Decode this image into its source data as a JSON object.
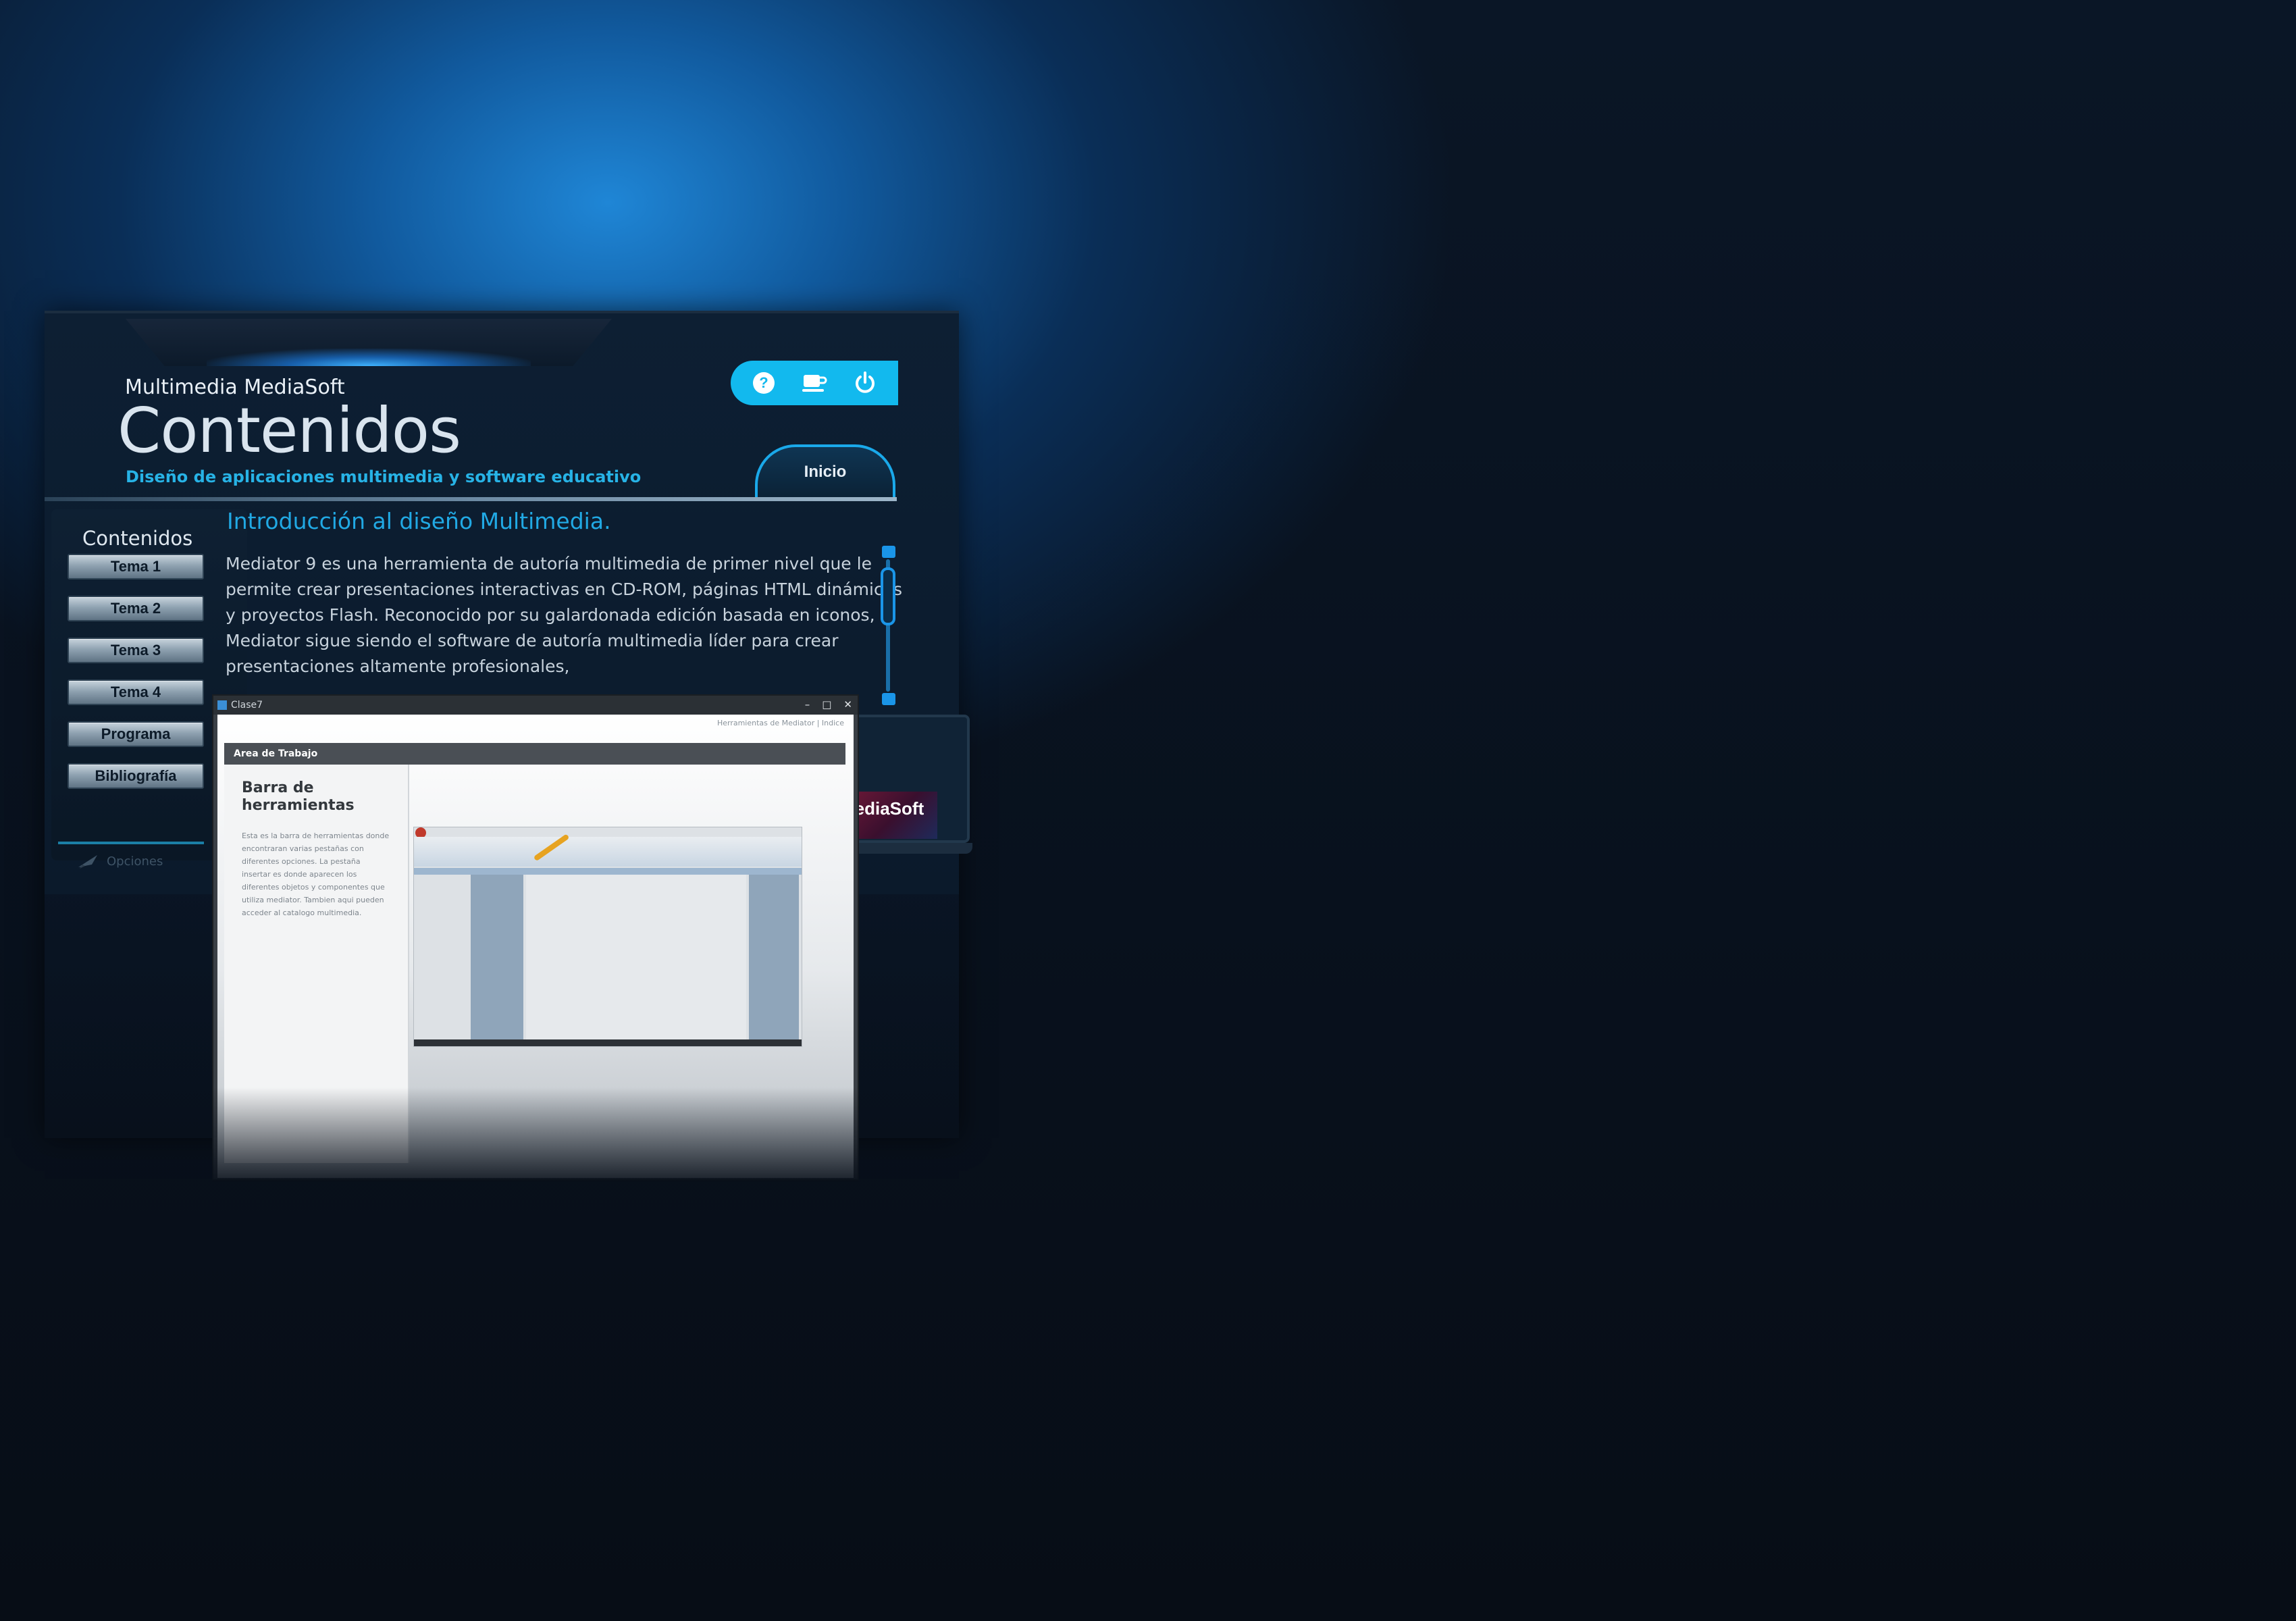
{
  "header": {
    "brand_small": "Multimedia MediaSoft",
    "brand_big": "Contenidos",
    "subtitle": "Diseño de aplicaciones multimedia y software educativo",
    "toolbar_icons": [
      "help-icon",
      "coffee-icon",
      "power-icon"
    ],
    "inicio_label": "Inicio"
  },
  "sidebar": {
    "title": "Contenidos",
    "items": [
      {
        "label": "Tema 1"
      },
      {
        "label": "Tema 2"
      },
      {
        "label": "Tema 3"
      },
      {
        "label": "Tema 4"
      },
      {
        "label": "Programa"
      },
      {
        "label": "Bibliografía"
      }
    ],
    "opciones_label": "Opciones"
  },
  "content": {
    "title": "Introducción al diseño Multimedia.",
    "body": "Mediator 9 es una herramienta de autoría multimedia de primer nivel que le permite crear presentaciones interactivas en CD-ROM, páginas HTML dinámicas y proyectos Flash. Reconocido por su galardonada edición basada en iconos, Mediator sigue siendo el software de autoría multimedia líder para crear presentaciones altamente profesionales,"
  },
  "screenshot": {
    "window_title": "Clase7",
    "breadcrumb": "Herramientas de Mediator  |  Indice",
    "section_bar": "Area de Trabajo",
    "heading": "Barra de herramientas",
    "paragraph": "Esta es la barra de herramientas donde encontraran varias pestañas con diferentes opciones. La pestaña insertar es donde aparecen los diferentes objetos y componentes que utiliza mediator. Tambien aqui pueden acceder al catalogo multimedia."
  },
  "laptop": {
    "brand": "MediaSoft"
  },
  "colors": {
    "accent": "#12b9ee",
    "title_blue": "#21a9e4",
    "background": "#070d16"
  }
}
